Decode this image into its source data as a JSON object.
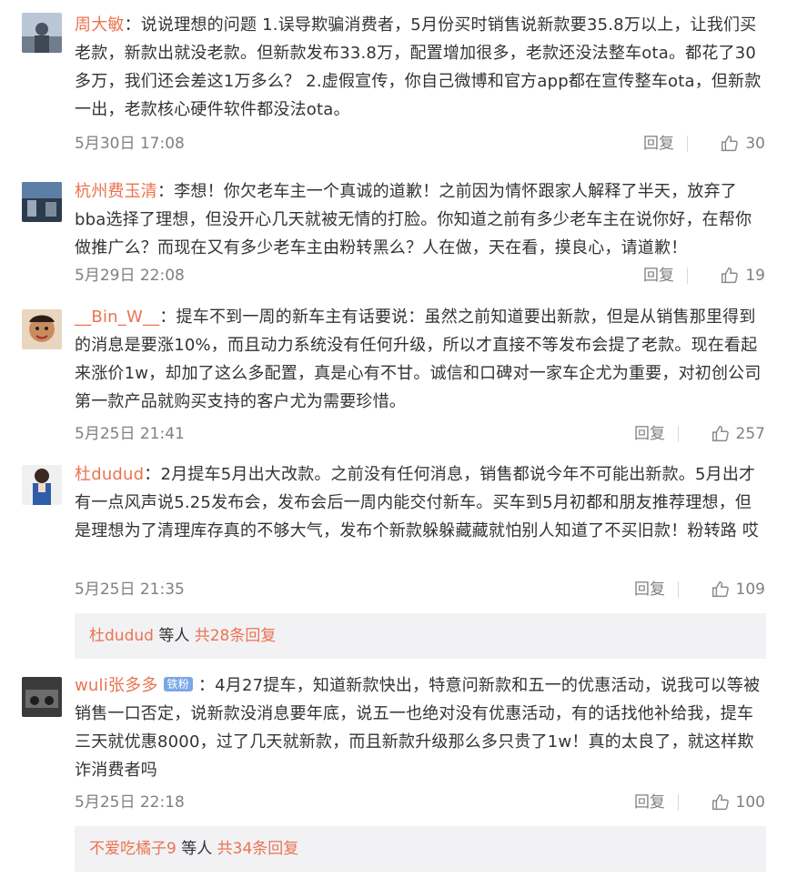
{
  "comments": [
    {
      "user": "周大敏",
      "text": "：说说理想的问题 1.误导欺骗消费者，5月份买时销售说新款要35.8万以上，让我们买老款，新款出就没老款。但新款发布33.8万，配置增加很多，老款还没法整车ota。都花了30多万，我们还会差这1万多么？ 2.虚假宣传，你自己微博和官方app都在宣传整车ota，但新款一出，老款核心硬件软件都没法ota。",
      "time": "5月30日 17:08",
      "reply_label": "回复",
      "likes": "30"
    },
    {
      "user": "杭州费玉清",
      "text": "：李想！你欠老车主一个真诚的道歉！之前因为情怀跟家人解释了半天，放弃了bba选择了理想，但没开心几天就被无情的打脸。你知道之前有多少老车主在说你好，在帮你做推广么？而现在又有多少老车主由粉转黑么？人在做，天在看，摸良心，请道歉！",
      "time": "5月29日 22:08",
      "reply_label": "回复",
      "likes": "19"
    },
    {
      "user": "__Bin_W__",
      "text": "：提车不到一周的新车主有话要说：虽然之前知道要出新款，但是从销售那里得到的消息是要涨10%，而且动力系统没有任何升级，所以才直接不等发布会提了老款。现在看起来涨价1w，却加了这么多配置，真是心有不甘。诚信和口碑对一家车企尤为重要，对初创公司第一款产品就购买支持的客户尤为需要珍惜。",
      "time": "5月25日 21:41",
      "reply_label": "回复",
      "likes": "257"
    },
    {
      "user": "杜dudud",
      "text": "：2月提车5月出大改款。之前没有任何消息，销售都说今年不可能出新款。5月出才有一点风声说5.25发布会，发布会后一周内能交付新车。买车到5月初都和朋友推荐理想，但是理想为了清理库存真的不够大气，发布个新款躲躲藏藏就怕别人知道了不买旧款！粉转路 哎",
      "time": "5月25日 21:35",
      "reply_label": "回复",
      "likes": "109",
      "more": {
        "users": "杜dudud",
        "mid": " 等人 ",
        "count": "共28条回复"
      }
    },
    {
      "user": "wuli张多多",
      "badge": "铁粉",
      "text": "：4月27提车，知道新款快出，特意问新款和五一的优惠活动，说我可以等被销售一口否定，说新款没消息要年底，说五一也绝对没有优惠活动，有的话找他补给我，提车三天就优惠8000，过了几天就新款，而且新款升级那么多只贵了1w！真的太良了，就这样欺诈消费者吗",
      "time": "5月25日 22:18",
      "reply_label": "回复",
      "likes": "100",
      "more": {
        "users": "不爱吃橘子9",
        "mid": " 等人 ",
        "count": "共34条回复"
      }
    }
  ],
  "colors": {
    "user": "#eb7350",
    "meta": "#808080",
    "text": "#333333"
  }
}
